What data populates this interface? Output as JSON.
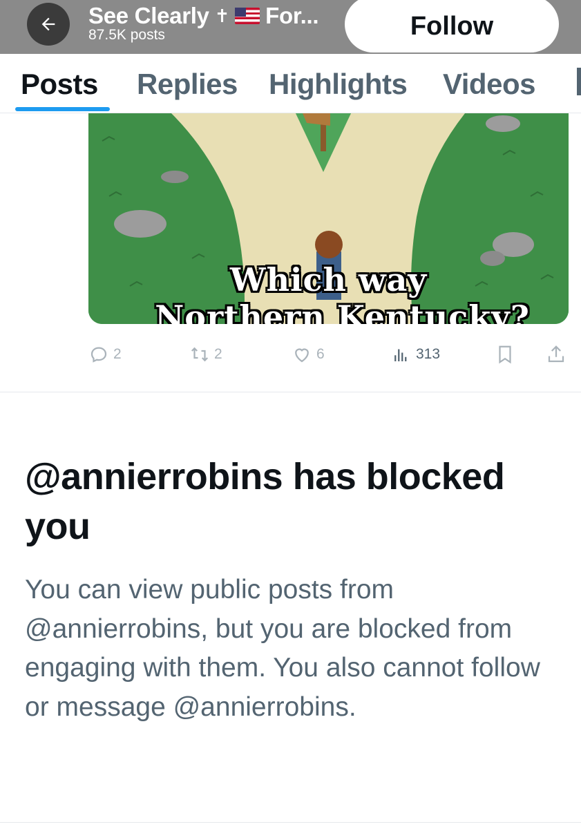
{
  "header": {
    "title": "See Clearly",
    "title_suffix": "For...",
    "cross_glyph": "✝",
    "flag_icon": "us-flag-icon",
    "posts_count": "87.5K posts",
    "follow_label": "Follow"
  },
  "tabs": [
    {
      "label": "Posts",
      "active": true
    },
    {
      "label": "Replies",
      "active": false
    },
    {
      "label": "Highlights",
      "active": false
    },
    {
      "label": "Videos",
      "active": false
    }
  ],
  "post": {
    "image_caption_line1": "Which way",
    "image_caption_line2": "Northern Kentucky?",
    "replies": "2",
    "reposts": "2",
    "likes": "6",
    "views": "313"
  },
  "blocked": {
    "title": "@annierrobins has blocked you",
    "body": "You can view public posts from @annierrobins, but you are blocked from engaging with them. You also cannot follow or message @annierrobins."
  },
  "colors": {
    "accent": "#1d9bf0",
    "header_bg": "#8a8a8a",
    "secondary_text": "#536471"
  }
}
